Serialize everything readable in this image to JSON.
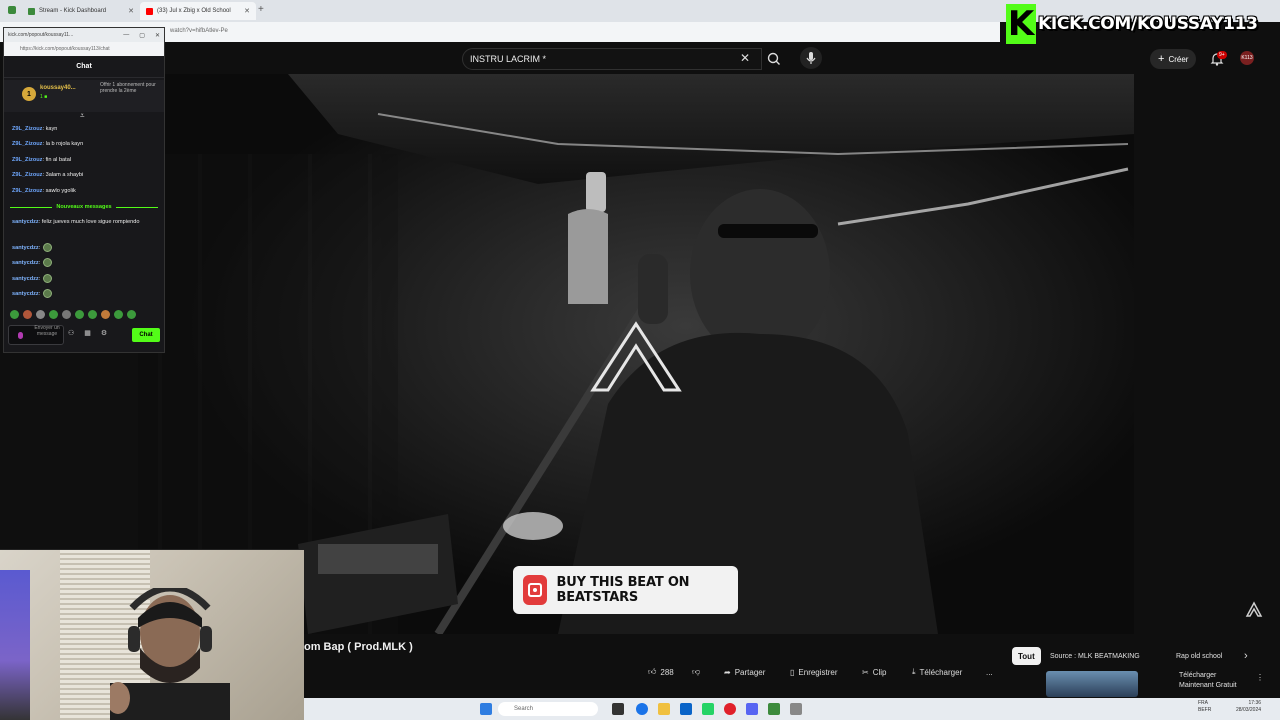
{
  "browser": {
    "tabs": [
      {
        "label": "Stream - Kick Dashboard",
        "favicon_color": "#3c8a3c"
      },
      {
        "label": "(33) Jul x Zbig x Old School",
        "favicon_color": "#ff0000"
      }
    ],
    "new_tab": "+",
    "address": "watch?v=hifbAtlev-Pe"
  },
  "kick_watermark": {
    "logo_letter": "K",
    "text": "KICK.COM/KOUSSAY113",
    "brand_color": "#53fc18"
  },
  "youtube": {
    "search_query": "INSTRU LACRIM *",
    "create_label": "Créer",
    "notif_badge": "9+",
    "avatar_text": "K113",
    "video_title": "om Bap ( Prod.MLK )",
    "actions": {
      "likes": "288",
      "share": "Partager",
      "save": "Enregistrer",
      "clip": "Clip",
      "download": "Télécharger",
      "more": "..."
    },
    "chips": {
      "all": "Tout",
      "source": "Source : MLK BEATMAKING",
      "rap": "Rap old school",
      "next": "›"
    },
    "recommendation": {
      "line1": "Télécharger",
      "line2": "Maintenant Gratuit",
      "more": "⋮"
    },
    "beatstars_label": "BUY THIS BEAT ON BEATSTARS"
  },
  "chat_popout": {
    "window_title": "kick.com/popout/koussay11...",
    "url": "https://kick.com/popout/koussay113/chat",
    "header": "Chat",
    "pinned": {
      "avatar": "1",
      "user": "koussay40...",
      "sub": "1 ■",
      "offer": "Offrir 1 abonnement pour prendre la 2ème"
    },
    "messages": [
      {
        "user": "Z9L_Zizouz",
        "text": "kayn"
      },
      {
        "user": "Z9L_Zizouz",
        "text": "la b rojola kayn"
      },
      {
        "user": "Z9L_Zizouz",
        "text": "fin al batal"
      },
      {
        "user": "Z9L_Zizouz",
        "text": "3alam a shaybi"
      },
      {
        "user": "Z9L_Zizouz",
        "text": "sawlo ygolik"
      }
    ],
    "new_messages_label": "Nouveaux messages",
    "new_messages": [
      {
        "user": "santycdzz",
        "text": "feliz jueves much love sigue rompiendo"
      },
      {
        "user": "santycdzz",
        "text": ""
      },
      {
        "user": "santycdzz",
        "text": ""
      },
      {
        "user": "santycdzz",
        "text": ""
      },
      {
        "user": "santycdzz",
        "text": ""
      }
    ],
    "input_placeholder": "Envoyer un message",
    "send_label": "Chat"
  },
  "taskbar": {
    "search_placeholder": "Search",
    "lang": "FRA",
    "lang2": "BEFR",
    "time": "17:36",
    "date": "28/03/2024"
  }
}
